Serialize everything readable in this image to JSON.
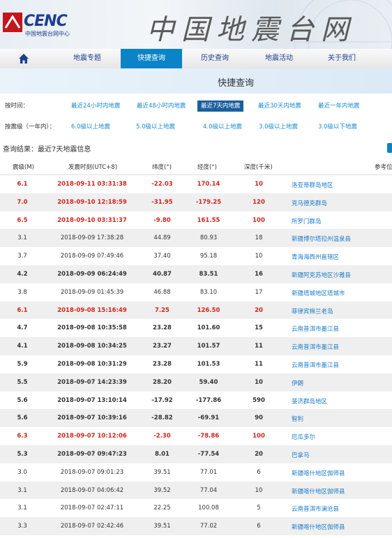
{
  "header": {
    "logo_text": "CENC",
    "logo_sub": "中国地震台网中心",
    "site_title": "中国地震台网"
  },
  "nav": {
    "home_icon": "home-icon",
    "items": [
      {
        "label": "地震专题",
        "active": false
      },
      {
        "label": "快捷查询",
        "active": true
      },
      {
        "label": "历史查询",
        "active": false
      },
      {
        "label": "地震活动",
        "active": false
      },
      {
        "label": "关于我们",
        "active": false
      }
    ]
  },
  "page_title": "快捷查询",
  "filters": {
    "time_label": "按时间：",
    "time_options": [
      "最近24小时内地震",
      "最近48小时内地震",
      "最近7天内地震",
      "最近30天内地震",
      "最近一年内地震"
    ],
    "time_selected": "最近7天内地震",
    "mag_label": "按震级（一年内）：",
    "mag_options": [
      "6.0级以上地震",
      "5.0级以上地震",
      "4.0级以上地震",
      "3.0级以上地震",
      "3.0级以下地震"
    ]
  },
  "result_text": "查询结果：最近7天地震信息",
  "table": {
    "headers": [
      "震级(M)",
      "发震时刻(UTC+8)",
      "纬度(°)",
      "经度(°)",
      "深度(千米)",
      "参考位"
    ],
    "rows": [
      {
        "m": "6.1",
        "t": "2018-09-11 03:31:38",
        "lat": "-22.03",
        "lon": "170.14",
        "d": "10",
        "loc": "洛亚蒂群岛地区",
        "style": "red"
      },
      {
        "m": "7.0",
        "t": "2018-09-10 12:18:59",
        "lat": "-31.95",
        "lon": "-179.25",
        "d": "120",
        "loc": "克马德克群岛",
        "style": "red"
      },
      {
        "m": "6.5",
        "t": "2018-09-10 03:31:37",
        "lat": "-9.80",
        "lon": "161.55",
        "d": "100",
        "loc": "所罗门群岛",
        "style": "red"
      },
      {
        "m": "3.1",
        "t": "2018-09-09 17:38:28",
        "lat": "44.89",
        "lon": "80.93",
        "d": "18",
        "loc": "新疆博尔塔拉州温泉县",
        "style": "normal"
      },
      {
        "m": "3.7",
        "t": "2018-09-09 07:49:46",
        "lat": "37.40",
        "lon": "95.18",
        "d": "10",
        "loc": "青海海西州直辖区",
        "style": "normal"
      },
      {
        "m": "4.2",
        "t": "2018-09-09 06:24:49",
        "lat": "40.87",
        "lon": "83.51",
        "d": "16",
        "loc": "新疆阿克苏地区沙雅县",
        "style": "bold"
      },
      {
        "m": "3.8",
        "t": "2018-09-09 01:45:39",
        "lat": "46.88",
        "lon": "83.10",
        "d": "17",
        "loc": "新疆塔城地区塔城市",
        "style": "normal"
      },
      {
        "m": "6.1",
        "t": "2018-09-08 15:16:49",
        "lat": "7.25",
        "lon": "126.50",
        "d": "20",
        "loc": "菲律宾棉兰老岛",
        "style": "red"
      },
      {
        "m": "4.7",
        "t": "2018-09-08 10:35:58",
        "lat": "23.28",
        "lon": "101.60",
        "d": "15",
        "loc": "云南普洱市墨江县",
        "style": "bold"
      },
      {
        "m": "4.1",
        "t": "2018-09-08 10:34:25",
        "lat": "23.27",
        "lon": "101.57",
        "d": "11",
        "loc": "云南普洱市墨江县",
        "style": "bold"
      },
      {
        "m": "5.9",
        "t": "2018-09-08 10:31:29",
        "lat": "23.28",
        "lon": "101.53",
        "d": "11",
        "loc": "云南普洱市墨江县",
        "style": "bold"
      },
      {
        "m": "5.5",
        "t": "2018-09-07 14:23:39",
        "lat": "28.20",
        "lon": "59.40",
        "d": "10",
        "loc": "伊朗",
        "style": "bold"
      },
      {
        "m": "5.6",
        "t": "2018-09-07 13:10:14",
        "lat": "-17.92",
        "lon": "-177.86",
        "d": "590",
        "loc": "斐济群岛地区",
        "style": "bold"
      },
      {
        "m": "5.6",
        "t": "2018-09-07 10:39:16",
        "lat": "-28.82",
        "lon": "-69.91",
        "d": "90",
        "loc": "智利",
        "style": "bold"
      },
      {
        "m": "6.3",
        "t": "2018-09-07 10:12:06",
        "lat": "-2.30",
        "lon": "-78.86",
        "d": "100",
        "loc": "厄瓜多尔",
        "style": "red"
      },
      {
        "m": "5.3",
        "t": "2018-09-07 09:47:23",
        "lat": "8.01",
        "lon": "-77.54",
        "d": "20",
        "loc": "巴拿马",
        "style": "bold"
      },
      {
        "m": "3.0",
        "t": "2018-09-07 09:01:23",
        "lat": "39.51",
        "lon": "77.01",
        "d": "6",
        "loc": "新疆喀什地区伽师县",
        "style": "normal"
      },
      {
        "m": "3.1",
        "t": "2018-09-07 04:06:42",
        "lat": "39.52",
        "lon": "77.04",
        "d": "10",
        "loc": "新疆喀什地区伽师县",
        "style": "normal"
      },
      {
        "m": "3.1",
        "t": "2018-09-07 02:47:11",
        "lat": "22.25",
        "lon": "100.08",
        "d": "5",
        "loc": "云南普洱市澜沧县",
        "style": "normal"
      },
      {
        "m": "3.3",
        "t": "2018-09-07 02:42:46",
        "lat": "39.51",
        "lon": "77.02",
        "d": "6",
        "loc": "新疆喀什地区伽师县",
        "style": "normal"
      }
    ]
  },
  "colors": {
    "accent": "#0a84c6",
    "red": "#d0261d",
    "link": "#1a7cc8"
  }
}
